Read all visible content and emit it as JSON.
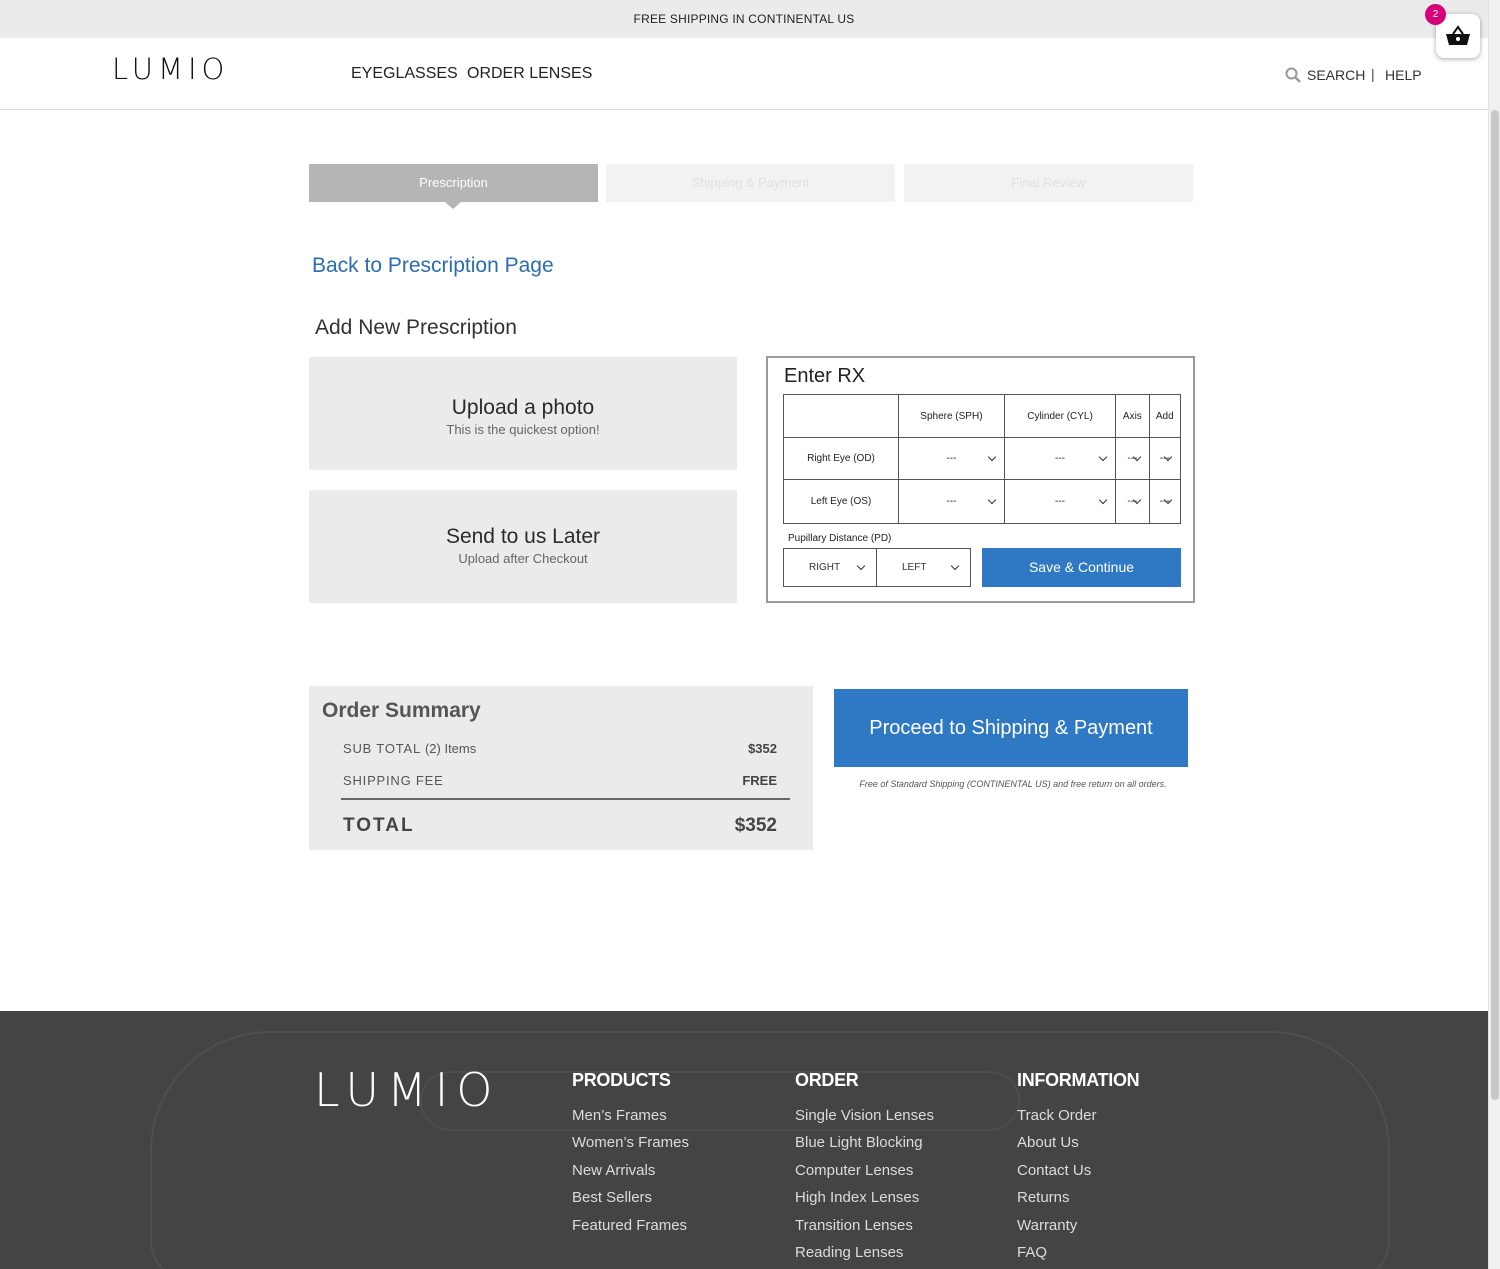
{
  "topbar": {
    "text": "FREE SHIPPING IN CONTINENTAL US"
  },
  "cart": {
    "count": "2"
  },
  "header": {
    "logo": "LUMIO",
    "nav": [
      "EYEGLASSES",
      "ORDER LENSES"
    ],
    "search_label": "SEARCH",
    "separator": "|",
    "help_label": "HELP"
  },
  "steps": [
    "Prescription",
    "Shipping & Payment",
    "Final Review"
  ],
  "back_link": "Back to Prescription Page",
  "add_title": "Add New Prescription",
  "options": {
    "upload": {
      "title": "Upload a photo",
      "subtitle": "This is the quickest option!"
    },
    "later": {
      "title": "Send to us Later",
      "subtitle": "Upload after Checkout"
    }
  },
  "rx": {
    "title": "Enter RX",
    "columns": [
      "Sphere (SPH)",
      "Cylinder (CYL)",
      "Axis",
      "Add"
    ],
    "rows": [
      {
        "label": "Right Eye (OD)",
        "values": [
          "---",
          "---",
          "---",
          "---"
        ]
      },
      {
        "label": "Left Eye (OS)",
        "values": [
          "---",
          "---",
          "---",
          "---"
        ]
      }
    ],
    "pd_label": "Pupillary Distance (PD)",
    "pd_right": "RIGHT",
    "pd_left": "LEFT",
    "save_button": "Save & Continue"
  },
  "summary": {
    "title": "Order Summary",
    "subtotal_label": "SUB TOTAL",
    "subtotal_items": "(2) Items",
    "subtotal_value": "$352",
    "shipping_label": "SHIPPING FEE",
    "shipping_value": "FREE",
    "total_label": "TOTAL",
    "total_value": "$352"
  },
  "proceed_button": "Proceed to Shipping & Payment",
  "free_note": "Free of Standard Shipping (CONTINENTAL US) and free return on all orders.",
  "footer": {
    "logo": "LUMIO",
    "columns": [
      {
        "title": "PRODUCTS",
        "links": [
          "Men’s Frames",
          "Women’s Frames",
          "New Arrivals",
          "Best Sellers",
          "Featured Frames"
        ]
      },
      {
        "title": "ORDER",
        "links": [
          "Single Vision Lenses",
          "Blue Light Blocking",
          "Computer Lenses",
          "High Index Lenses",
          "Transition Lenses",
          "Reading Lenses"
        ]
      },
      {
        "title": "INFORMATION",
        "links": [
          "Track Order",
          "About Us",
          "Contact Us",
          "Returns",
          "Warranty",
          "FAQ"
        ]
      }
    ]
  }
}
